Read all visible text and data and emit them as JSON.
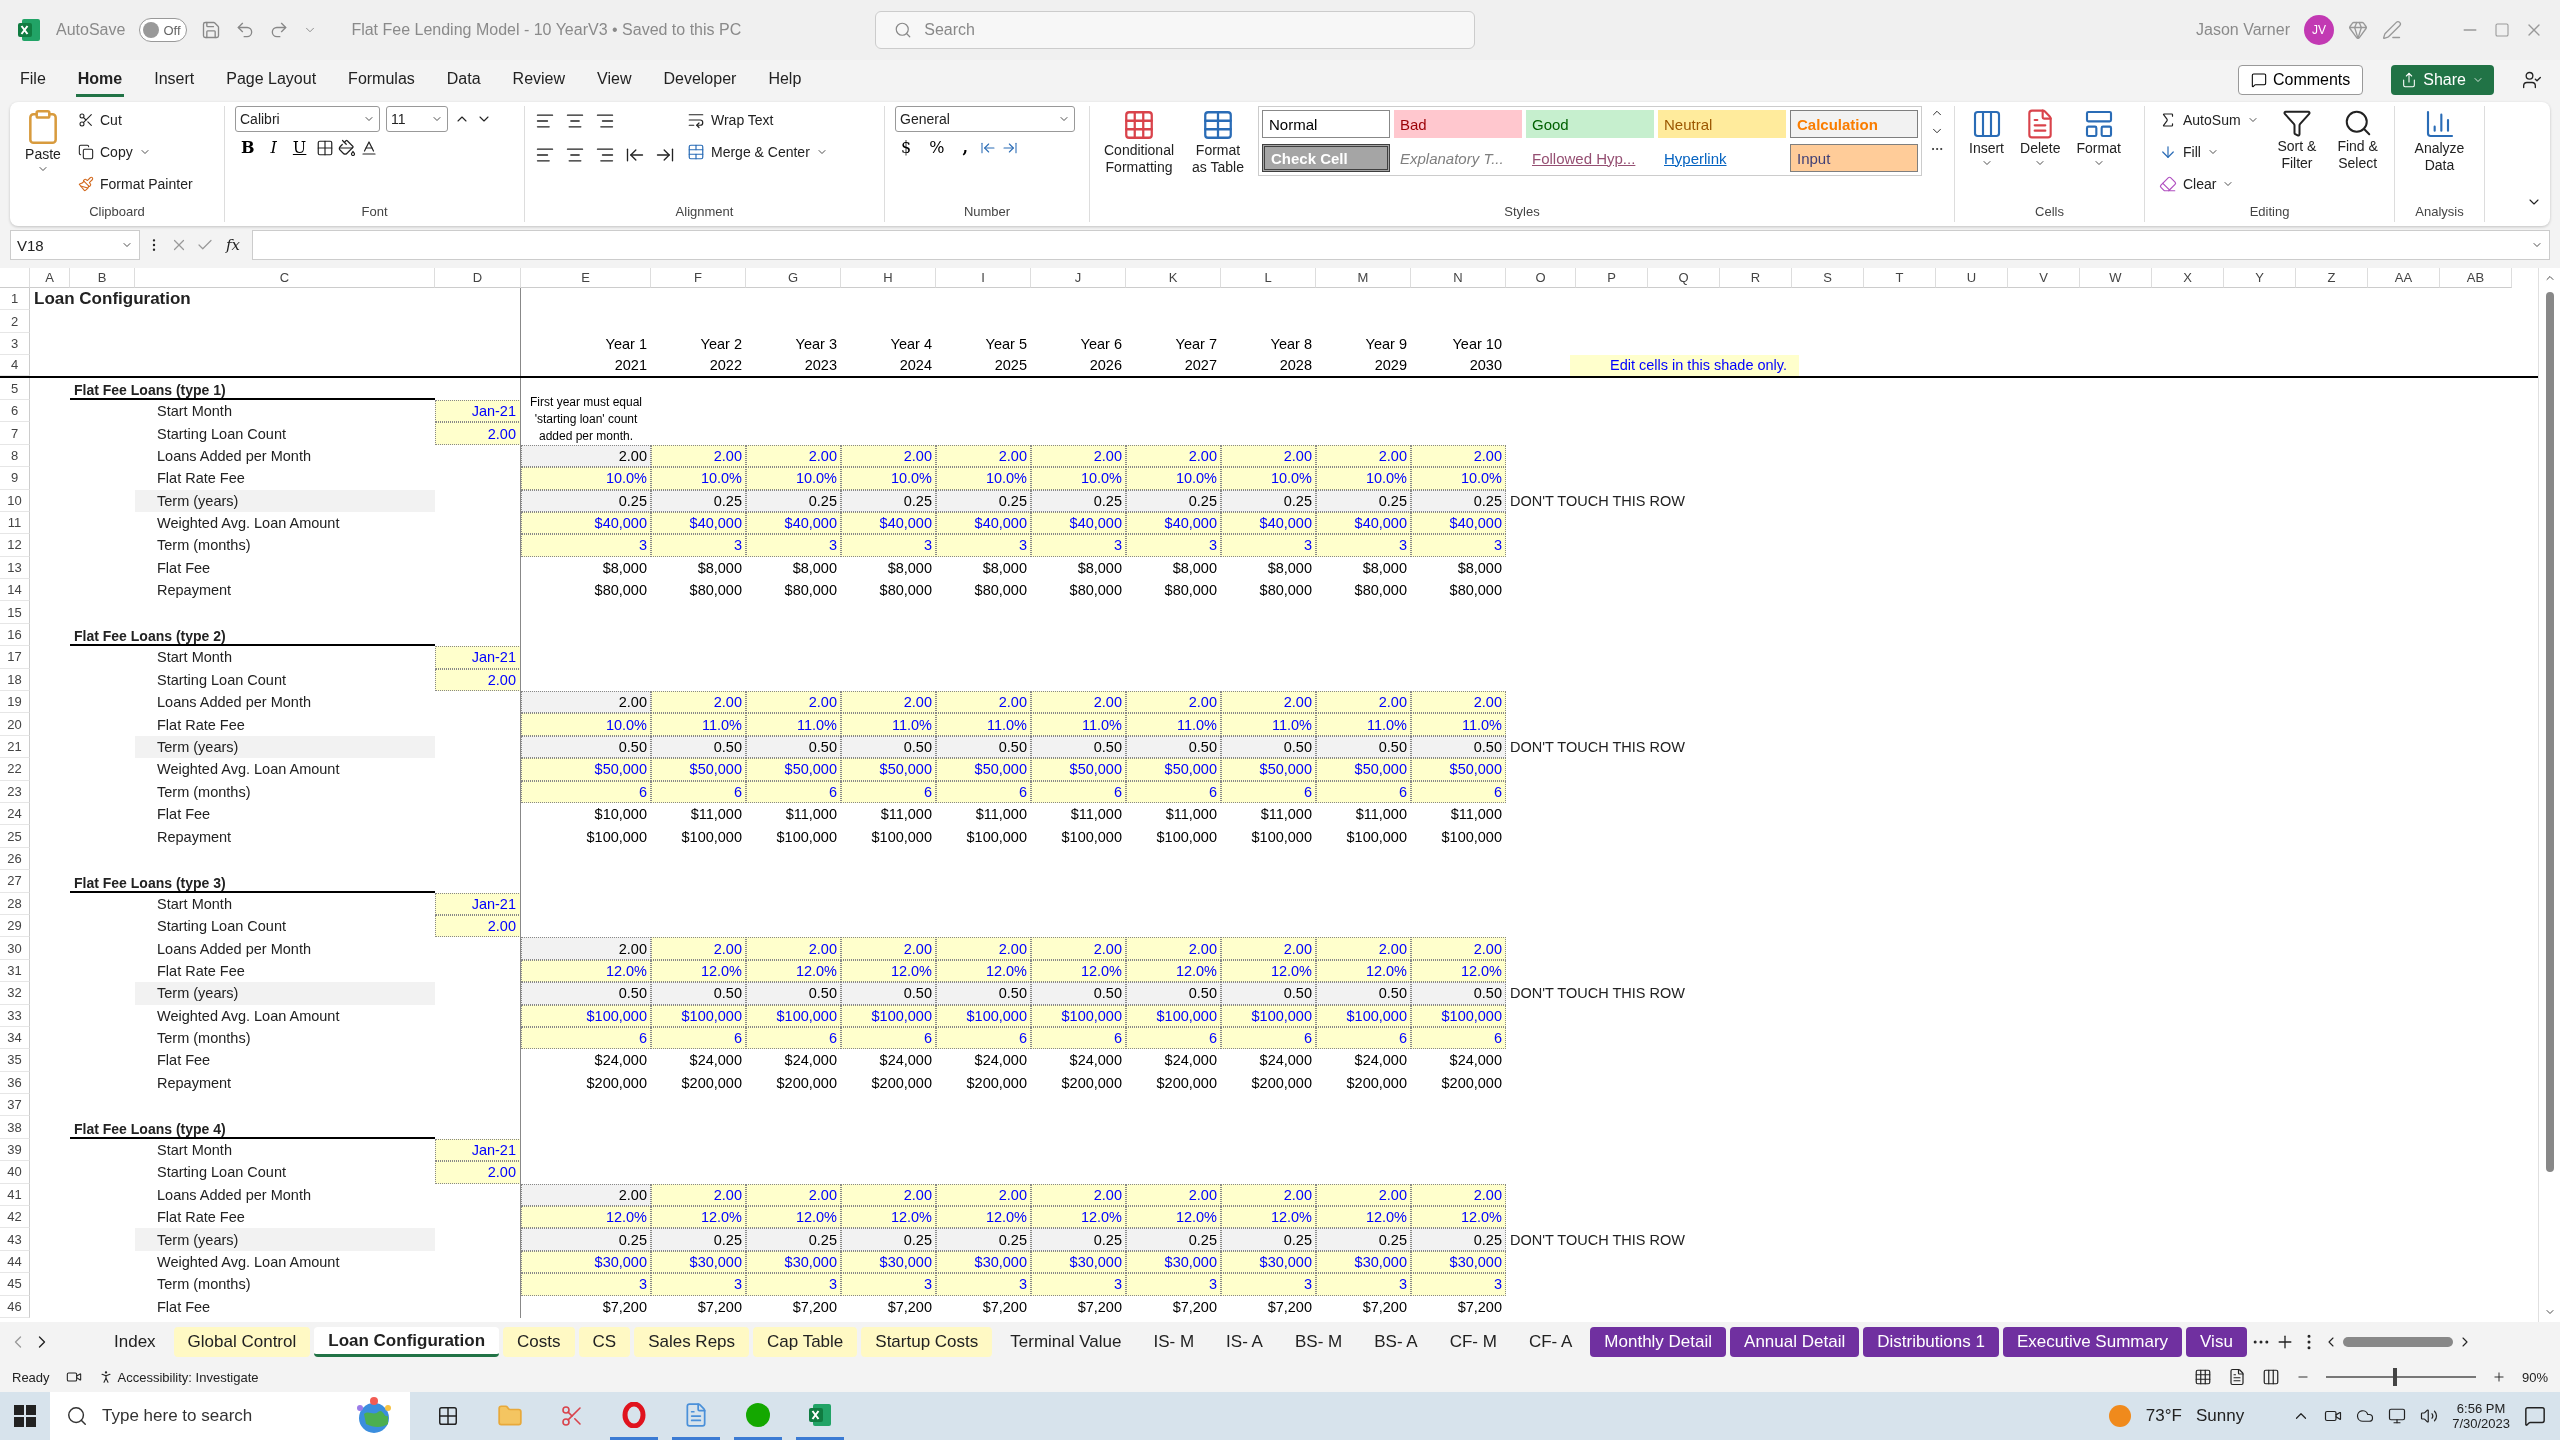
{
  "title_bar": {
    "autosave_label": "AutoSave",
    "autosave": {
      "on": false,
      "label": "Off"
    },
    "document": "Flat Fee Lending Model - 10 YearV3 • Saved to this PC",
    "search_placeholder": "Search",
    "user": "Jason Varner",
    "avatar": "JV"
  },
  "menu": {
    "tabs": [
      {
        "label": "File",
        "selected": false
      },
      {
        "label": "Home",
        "selected": true
      },
      {
        "label": "Insert",
        "selected": false
      },
      {
        "label": "Page Layout",
        "selected": false
      },
      {
        "label": "Formulas",
        "selected": false
      },
      {
        "label": "Data",
        "selected": false
      },
      {
        "label": "Review",
        "selected": false
      },
      {
        "label": "View",
        "selected": false
      },
      {
        "label": "Developer",
        "selected": false
      },
      {
        "label": "Help",
        "selected": false
      }
    ],
    "comments": "Comments",
    "share": "Share"
  },
  "ribbon": {
    "clipboard": {
      "title": "Clipboard",
      "paste": "Paste",
      "cut": "Cut",
      "copy": "Copy",
      "format_painter": "Format Painter"
    },
    "font": {
      "title": "Font",
      "name": "Calibri",
      "size": "11",
      "bold": "B",
      "italic": "I",
      "underline": "U"
    },
    "alignment": {
      "title": "Alignment",
      "wrap": "Wrap Text",
      "merge": "Merge & Center"
    },
    "number": {
      "title": "Number",
      "format": "General",
      "currency": "$",
      "percent": "%",
      "comma": ","
    },
    "styles": {
      "title": "Styles",
      "conditional": "Conditional Formatting",
      "format_table": "Format as Table",
      "items": [
        {
          "label": "Normal",
          "kind": "normal"
        },
        {
          "label": "Bad",
          "kind": "bad"
        },
        {
          "label": "Good",
          "kind": "good"
        },
        {
          "label": "Neutral",
          "kind": "neutral"
        },
        {
          "label": "Calculation",
          "kind": "calculation"
        },
        {
          "label": "Check Cell",
          "kind": "check"
        },
        {
          "label": "Explanatory T...",
          "kind": "explanatory"
        },
        {
          "label": "Followed Hyp...",
          "kind": "followed"
        },
        {
          "label": "Hyperlink",
          "kind": "hyperlink"
        },
        {
          "label": "Input",
          "kind": "input"
        }
      ]
    },
    "cells": {
      "title": "Cells",
      "buttons": [
        "Insert",
        "Delete",
        "Format"
      ]
    },
    "editing": {
      "title": "Editing",
      "autosum": "AutoSum",
      "fill": "Fill",
      "clear": "Clear",
      "sort": "Sort & Filter",
      "find": "Find & Select"
    },
    "analysis": {
      "title": "Analysis",
      "analyze": "Analyze Data"
    }
  },
  "formula_bar": {
    "name_box": "V18",
    "fx": "fx"
  },
  "grid": {
    "columns": [
      "A",
      "B",
      "C",
      "D",
      "E",
      "F",
      "G",
      "H",
      "I",
      "J",
      "K",
      "L",
      "M",
      "N",
      "O",
      "P",
      "Q",
      "R",
      "S",
      "T",
      "U",
      "V",
      "W",
      "X",
      "Y",
      "Z",
      "AA",
      "AB"
    ],
    "rows": [
      {
        "n": "1",
        "kind": "title",
        "label": "Loan Configuration"
      },
      {
        "n": "2",
        "kind": "blank"
      },
      {
        "n": "3",
        "kind": "header",
        "values": [
          "Year 1",
          "Year 2",
          "Year 3",
          "Year 4",
          "Year 5",
          "Year 6",
          "Year 7",
          "Year 8",
          "Year 9",
          "Year 10"
        ]
      },
      {
        "n": "4",
        "kind": "header_rule",
        "values": [
          "2021",
          "2022",
          "2023",
          "2024",
          "2025",
          "2026",
          "2027",
          "2028",
          "2029",
          "2030"
        ],
        "legend": "Edit cells in this shade only."
      },
      {
        "n": "5",
        "kind": "section",
        "label": "Flat Fee Loans (type 1)"
      },
      {
        "n": "6",
        "kind": "param",
        "label": "Start Month",
        "value": "Jan-21",
        "note": "First year must equal 'starting loan' count added per month."
      },
      {
        "n": "7",
        "kind": "param",
        "label": "Starting Loan Count",
        "value": "2.00"
      },
      {
        "n": "8",
        "kind": "input",
        "label": "Loans Added per Month",
        "first_locked": true,
        "values": [
          "2.00",
          "2.00",
          "2.00",
          "2.00",
          "2.00",
          "2.00",
          "2.00",
          "2.00",
          "2.00",
          "2.00"
        ]
      },
      {
        "n": "9",
        "kind": "input",
        "label": "Flat Rate Fee",
        "first_locked": false,
        "values": [
          "10.0%",
          "10.0%",
          "10.0%",
          "10.0%",
          "10.0%",
          "10.0%",
          "10.0%",
          "10.0%",
          "10.0%",
          "10.0%"
        ]
      },
      {
        "n": "10",
        "kind": "locked",
        "label": "Term (years)",
        "values": [
          "0.25",
          "0.25",
          "0.25",
          "0.25",
          "0.25",
          "0.25",
          "0.25",
          "0.25",
          "0.25",
          "0.25"
        ],
        "remark": "DON'T TOUCH THIS ROW"
      },
      {
        "n": "11",
        "kind": "input",
        "label": "Weighted Avg. Loan Amount",
        "first_locked": false,
        "values": [
          "$40,000",
          "$40,000",
          "$40,000",
          "$40,000",
          "$40,000",
          "$40,000",
          "$40,000",
          "$40,000",
          "$40,000",
          "$40,000"
        ]
      },
      {
        "n": "12",
        "kind": "input",
        "label": "Term (months)",
        "first_locked": false,
        "values": [
          "3",
          "3",
          "3",
          "3",
          "3",
          "3",
          "3",
          "3",
          "3",
          "3"
        ]
      },
      {
        "n": "13",
        "kind": "calc",
        "label": "Flat Fee",
        "first_locked": false,
        "values": [
          "$8,000",
          "$8,000",
          "$8,000",
          "$8,000",
          "$8,000",
          "$8,000",
          "$8,000",
          "$8,000",
          "$8,000",
          "$8,000"
        ]
      },
      {
        "n": "14",
        "kind": "calc",
        "label": "Repayment",
        "first_locked": false,
        "values": [
          "$80,000",
          "$80,000",
          "$80,000",
          "$80,000",
          "$80,000",
          "$80,000",
          "$80,000",
          "$80,000",
          "$80,000",
          "$80,000"
        ]
      },
      {
        "n": "15",
        "kind": "blank"
      },
      {
        "n": "16",
        "kind": "section",
        "label": "Flat Fee Loans (type 2)"
      },
      {
        "n": "17",
        "kind": "param",
        "label": "Start Month",
        "value": "Jan-21"
      },
      {
        "n": "18",
        "kind": "param",
        "label": "Starting Loan Count",
        "value": "2.00"
      },
      {
        "n": "19",
        "kind": "input",
        "label": "Loans Added per Month",
        "first_locked": true,
        "values": [
          "2.00",
          "2.00",
          "2.00",
          "2.00",
          "2.00",
          "2.00",
          "2.00",
          "2.00",
          "2.00",
          "2.00"
        ]
      },
      {
        "n": "20",
        "kind": "input",
        "label": "Flat Rate Fee",
        "first_locked": false,
        "values": [
          "10.0%",
          "11.0%",
          "11.0%",
          "11.0%",
          "11.0%",
          "11.0%",
          "11.0%",
          "11.0%",
          "11.0%",
          "11.0%"
        ]
      },
      {
        "n": "21",
        "kind": "locked",
        "label": "Term (years)",
        "values": [
          "0.50",
          "0.50",
          "0.50",
          "0.50",
          "0.50",
          "0.50",
          "0.50",
          "0.50",
          "0.50",
          "0.50"
        ],
        "remark": "DON'T TOUCH THIS ROW"
      },
      {
        "n": "22",
        "kind": "input",
        "label": "Weighted Avg. Loan Amount",
        "first_locked": false,
        "values": [
          "$50,000",
          "$50,000",
          "$50,000",
          "$50,000",
          "$50,000",
          "$50,000",
          "$50,000",
          "$50,000",
          "$50,000",
          "$50,000"
        ]
      },
      {
        "n": "23",
        "kind": "input",
        "label": "Term (months)",
        "first_locked": false,
        "values": [
          "6",
          "6",
          "6",
          "6",
          "6",
          "6",
          "6",
          "6",
          "6",
          "6"
        ]
      },
      {
        "n": "24",
        "kind": "calc",
        "label": "Flat Fee",
        "first_locked": false,
        "values": [
          "$10,000",
          "$11,000",
          "$11,000",
          "$11,000",
          "$11,000",
          "$11,000",
          "$11,000",
          "$11,000",
          "$11,000",
          "$11,000"
        ]
      },
      {
        "n": "25",
        "kind": "calc",
        "label": "Repayment",
        "first_locked": false,
        "values": [
          "$100,000",
          "$100,000",
          "$100,000",
          "$100,000",
          "$100,000",
          "$100,000",
          "$100,000",
          "$100,000",
          "$100,000",
          "$100,000"
        ]
      },
      {
        "n": "26",
        "kind": "blank"
      },
      {
        "n": "27",
        "kind": "section",
        "label": "Flat Fee Loans (type 3)"
      },
      {
        "n": "28",
        "kind": "param",
        "label": "Start Month",
        "value": "Jan-21"
      },
      {
        "n": "29",
        "kind": "param",
        "label": "Starting Loan Count",
        "value": "2.00"
      },
      {
        "n": "30",
        "kind": "input",
        "label": "Loans Added per Month",
        "first_locked": true,
        "values": [
          "2.00",
          "2.00",
          "2.00",
          "2.00",
          "2.00",
          "2.00",
          "2.00",
          "2.00",
          "2.00",
          "2.00"
        ]
      },
      {
        "n": "31",
        "kind": "input",
        "label": "Flat Rate Fee",
        "first_locked": false,
        "values": [
          "12.0%",
          "12.0%",
          "12.0%",
          "12.0%",
          "12.0%",
          "12.0%",
          "12.0%",
          "12.0%",
          "12.0%",
          "12.0%"
        ]
      },
      {
        "n": "32",
        "kind": "locked",
        "label": "Term (years)",
        "values": [
          "0.50",
          "0.50",
          "0.50",
          "0.50",
          "0.50",
          "0.50",
          "0.50",
          "0.50",
          "0.50",
          "0.50"
        ],
        "remark": "DON'T TOUCH THIS ROW"
      },
      {
        "n": "33",
        "kind": "input",
        "label": "Weighted Avg. Loan Amount",
        "first_locked": false,
        "values": [
          "$100,000",
          "$100,000",
          "$100,000",
          "$100,000",
          "$100,000",
          "$100,000",
          "$100,000",
          "$100,000",
          "$100,000",
          "$100,000"
        ]
      },
      {
        "n": "34",
        "kind": "input",
        "label": "Term (months)",
        "first_locked": false,
        "values": [
          "6",
          "6",
          "6",
          "6",
          "6",
          "6",
          "6",
          "6",
          "6",
          "6"
        ]
      },
      {
        "n": "35",
        "kind": "calc",
        "label": "Flat Fee",
        "first_locked": false,
        "values": [
          "$24,000",
          "$24,000",
          "$24,000",
          "$24,000",
          "$24,000",
          "$24,000",
          "$24,000",
          "$24,000",
          "$24,000",
          "$24,000"
        ]
      },
      {
        "n": "36",
        "kind": "calc",
        "label": "Repayment",
        "first_locked": false,
        "values": [
          "$200,000",
          "$200,000",
          "$200,000",
          "$200,000",
          "$200,000",
          "$200,000",
          "$200,000",
          "$200,000",
          "$200,000",
          "$200,000"
        ]
      },
      {
        "n": "37",
        "kind": "blank"
      },
      {
        "n": "38",
        "kind": "section",
        "label": "Flat Fee Loans (type 4)"
      },
      {
        "n": "39",
        "kind": "param",
        "label": "Start Month",
        "value": "Jan-21"
      },
      {
        "n": "40",
        "kind": "param",
        "label": "Starting Loan Count",
        "value": "2.00"
      },
      {
        "n": "41",
        "kind": "input",
        "label": "Loans Added per Month",
        "first_locked": true,
        "values": [
          "2.00",
          "2.00",
          "2.00",
          "2.00",
          "2.00",
          "2.00",
          "2.00",
          "2.00",
          "2.00",
          "2.00"
        ]
      },
      {
        "n": "42",
        "kind": "input",
        "label": "Flat Rate Fee",
        "first_locked": false,
        "values": [
          "12.0%",
          "12.0%",
          "12.0%",
          "12.0%",
          "12.0%",
          "12.0%",
          "12.0%",
          "12.0%",
          "12.0%",
          "12.0%"
        ]
      },
      {
        "n": "43",
        "kind": "locked",
        "label": "Term (years)",
        "values": [
          "0.25",
          "0.25",
          "0.25",
          "0.25",
          "0.25",
          "0.25",
          "0.25",
          "0.25",
          "0.25",
          "0.25"
        ],
        "remark": "DON'T TOUCH THIS ROW"
      },
      {
        "n": "44",
        "kind": "input",
        "label": "Weighted Avg. Loan Amount",
        "first_locked": false,
        "values": [
          "$30,000",
          "$30,000",
          "$30,000",
          "$30,000",
          "$30,000",
          "$30,000",
          "$30,000",
          "$30,000",
          "$30,000",
          "$30,000"
        ]
      },
      {
        "n": "45",
        "kind": "input",
        "label": "Term (months)",
        "first_locked": false,
        "values": [
          "3",
          "3",
          "3",
          "3",
          "3",
          "3",
          "3",
          "3",
          "3",
          "3"
        ]
      },
      {
        "n": "46",
        "kind": "calc",
        "label": "Flat Fee",
        "first_locked": false,
        "values": [
          "$7,200",
          "$7,200",
          "$7,200",
          "$7,200",
          "$7,200",
          "$7,200",
          "$7,200",
          "$7,200",
          "$7,200",
          "$7,200"
        ]
      }
    ]
  },
  "sheet_tabs": [
    {
      "label": "Index",
      "selected": false
    },
    {
      "label": "Global Control",
      "selected": false,
      "color": "#fff9c4"
    },
    {
      "label": "Loan Configuration",
      "selected": true
    },
    {
      "label": "Costs",
      "selected": false,
      "color": "#fff9c4"
    },
    {
      "label": "CS",
      "selected": false,
      "color": "#fff9c4"
    },
    {
      "label": "Sales Reps",
      "selected": false,
      "color": "#fff9c4"
    },
    {
      "label": "Cap Table",
      "selected": false,
      "color": "#fff9c4"
    },
    {
      "label": "Startup Costs",
      "selected": false,
      "color": "#fff9c4"
    },
    {
      "label": "Terminal Value",
      "selected": false
    },
    {
      "label": "IS- M",
      "selected": false
    },
    {
      "label": "IS- A",
      "selected": false
    },
    {
      "label": "BS- M",
      "selected": false
    },
    {
      "label": "BS- A",
      "selected": false
    },
    {
      "label": "CF- M",
      "selected": false
    },
    {
      "label": "CF- A",
      "selected": false
    },
    {
      "label": "Monthly Detail",
      "selected": false,
      "color": "#7030a0"
    },
    {
      "label": "Annual Detail",
      "selected": false,
      "color": "#7030a0"
    },
    {
      "label": "Distributions 1",
      "selected": false,
      "color": "#7030a0"
    },
    {
      "label": "Executive Summary",
      "selected": false,
      "color": "#7030a0"
    },
    {
      "label": "Visu",
      "selected": false,
      "color": "#7030a0"
    }
  ],
  "status_bar": {
    "ready": "Ready",
    "accessibility": "Accessibility: Investigate",
    "zoom": {
      "reading": "90%",
      "level": 0.45
    }
  },
  "taskbar": {
    "search_placeholder": "Type here to search",
    "temperature": "73°F",
    "weather": "Sunny",
    "time": "6:56 PM",
    "date": "7/30/2023"
  }
}
